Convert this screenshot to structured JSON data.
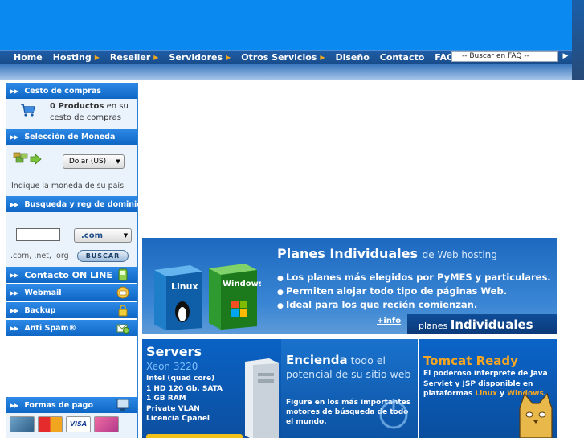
{
  "nav": {
    "items": [
      {
        "label": "Home",
        "has_submenu": false
      },
      {
        "label": "Hosting",
        "has_submenu": true
      },
      {
        "label": "Reseller",
        "has_submenu": true
      },
      {
        "label": "Servidores",
        "has_submenu": true
      },
      {
        "label": "Otros Servicios",
        "has_submenu": true
      },
      {
        "label": "Diseño",
        "has_submenu": false
      },
      {
        "label": "Contacto",
        "has_submenu": false
      },
      {
        "label": "FAQs",
        "has_submenu": false
      }
    ],
    "faq_search_value": "-- Buscar en FAQ --"
  },
  "sidebar": {
    "cart": {
      "heading": "Cesto de compras",
      "count_label": "0 Productos",
      "suffix": "en su cesto de compras"
    },
    "currency": {
      "heading": "Selección de Moneda",
      "selected": "Dolar (US)",
      "note": "Indique la moneda de su país"
    },
    "domain": {
      "heading": "Busqueda y reg de dominio",
      "tld_selected": ".com",
      "tld_examples": ".com, .net, .org",
      "search_button": "BUSCAR"
    },
    "links": [
      {
        "label": "Contacto ON LINE",
        "icon": "phone-icon"
      },
      {
        "label": "Webmail",
        "icon": "mail-icon"
      },
      {
        "label": "Backup",
        "icon": "lock-icon"
      },
      {
        "label": "Anti Spam®",
        "icon": "envelope-shield-icon"
      }
    ],
    "payment": {
      "heading": "Formas de pago",
      "cards": [
        "mastercard",
        "visa",
        "other"
      ]
    }
  },
  "banner_planes": {
    "title": "Planes Individuales",
    "subtitle": "de Web hosting",
    "bullets": [
      "Los planes más elegidos por PyMES y particulares.",
      "Permiten alojar todo tipo de páginas Web.",
      "Ideal para los que recién comienzan."
    ],
    "info_link": "+info",
    "tag_prefix": "planes",
    "tag_strong": "Individuales",
    "box_labels": [
      "Linux",
      "Windows"
    ]
  },
  "servers": {
    "title": "Servers",
    "subtitle": "Xeon 3220",
    "specs": [
      "Intel (quad core)",
      "1 HD 120 Gb. SATA",
      "1 GB RAM",
      "Private VLAN",
      "Licencia Cpanel"
    ]
  },
  "encienda": {
    "title_bold": "Encienda",
    "title_rest": "todo el potencial de su sitio web",
    "text": "Figure en los más importantes motores de búsqueda de todo el mundo."
  },
  "tomcat": {
    "title": "Tomcat Ready",
    "text_before": "El poderoso interprete de Java Servlet y JSP disponible en plataformas",
    "linux": "Linux",
    "and": "y",
    "windows": "Windows",
    "end": "."
  },
  "colors": {
    "brand_blue": "#0a89f0",
    "nav_arrow": "#f2a81e",
    "accent_orange": "#f5a623"
  }
}
